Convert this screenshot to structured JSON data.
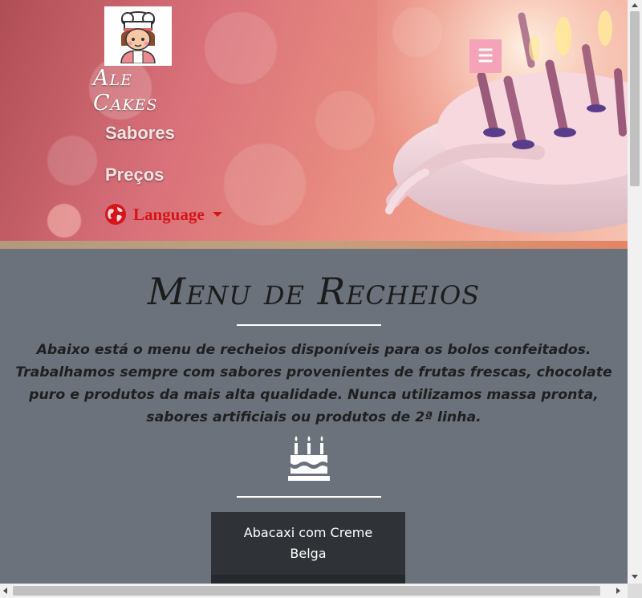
{
  "header": {
    "brand": "Ale Cakes",
    "menu_toggle_icon": "hamburger-menu-icon",
    "nav": [
      {
        "label": "Sabores"
      },
      {
        "label": "Preços"
      }
    ],
    "language": {
      "label": "Language",
      "icon": "globe-icon"
    }
  },
  "main": {
    "title": "Menu de Recheios",
    "intro": "Abaixo está o menu de recheios disponíveis para os bolos confeitados. Trabalhamos sempre com sabores provenientes de frutas frescas, chocolate puro e produtos da mais alta qualidade. Nunca utilizamos massa pronta, sabores artificiais ou produtos de 2ª linha.",
    "divider_icon": "birthday-cake-icon",
    "flavors": [
      {
        "name": "Abacaxi com Creme Belga"
      }
    ]
  },
  "colors": {
    "section_background": "#6b727c",
    "card_background": "#2f3237",
    "language_red": "#d4151b",
    "toggle_pink": "#f4a3b8"
  }
}
